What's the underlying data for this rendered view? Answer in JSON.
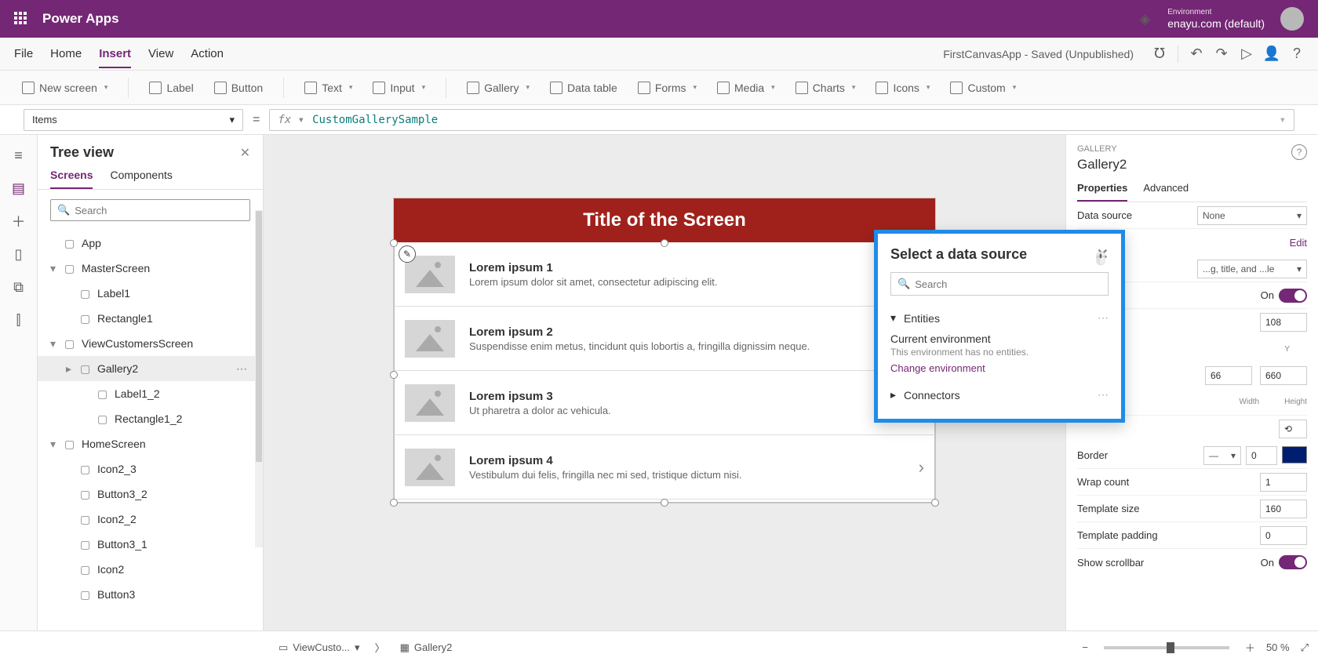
{
  "topbar": {
    "brand": "Power Apps",
    "env_label": "Environment",
    "env_value": "enayu.com (default)"
  },
  "menus": [
    "File",
    "Home",
    "Insert",
    "View",
    "Action"
  ],
  "menu_active": 2,
  "app_status": "FirstCanvasApp - Saved (Unpublished)",
  "ribbon": {
    "new_screen": "New screen",
    "label": "Label",
    "button": "Button",
    "text": "Text",
    "input": "Input",
    "gallery": "Gallery",
    "data_table": "Data table",
    "forms": "Forms",
    "media": "Media",
    "charts": "Charts",
    "icons": "Icons",
    "custom": "Custom"
  },
  "formula": {
    "prop": "Items",
    "value": "CustomGallerySample",
    "fx": "fx"
  },
  "tree": {
    "title": "Tree view",
    "tabs": [
      "Screens",
      "Components"
    ],
    "search_placeholder": "Search",
    "nodes": [
      {
        "label": "App",
        "level": 0,
        "icon": "app"
      },
      {
        "label": "MasterScreen",
        "level": 0,
        "icon": "screen",
        "exp": true
      },
      {
        "label": "Label1",
        "level": 1,
        "icon": "label"
      },
      {
        "label": "Rectangle1",
        "level": 1,
        "icon": "shape"
      },
      {
        "label": "ViewCustomersScreen",
        "level": 0,
        "icon": "screen",
        "exp": true
      },
      {
        "label": "Gallery2",
        "level": 1,
        "icon": "gallery",
        "selected": true,
        "more": true
      },
      {
        "label": "Label1_2",
        "level": 2,
        "icon": "label"
      },
      {
        "label": "Rectangle1_2",
        "level": 2,
        "icon": "shape"
      },
      {
        "label": "HomeScreen",
        "level": 0,
        "icon": "screen",
        "exp": true
      },
      {
        "label": "Icon2_3",
        "level": 1,
        "icon": "ico"
      },
      {
        "label": "Button3_2",
        "level": 1,
        "icon": "btn"
      },
      {
        "label": "Icon2_2",
        "level": 1,
        "icon": "ico"
      },
      {
        "label": "Button3_1",
        "level": 1,
        "icon": "btn"
      },
      {
        "label": "Icon2",
        "level": 1,
        "icon": "ico"
      },
      {
        "label": "Button3",
        "level": 1,
        "icon": "btn"
      }
    ]
  },
  "canvas": {
    "screen_title": "Title of the Screen",
    "rows": [
      {
        "title": "Lorem ipsum 1",
        "sub": "Lorem ipsum dolor sit amet, consectetur adipiscing elit."
      },
      {
        "title": "Lorem ipsum 2",
        "sub": "Suspendisse enim metus, tincidunt quis lobortis a, fringilla dignissim neque."
      },
      {
        "title": "Lorem ipsum 3",
        "sub": "Ut pharetra a dolor ac vehicula."
      },
      {
        "title": "Lorem ipsum 4",
        "sub": "Vestibulum dui felis, fringilla nec mi sed, tristique dictum nisi."
      }
    ]
  },
  "right": {
    "type_label": "GALLERY",
    "name": "Gallery2",
    "tabs": [
      "Properties",
      "Advanced"
    ],
    "data_source_label": "Data source",
    "data_source_value": "None",
    "edit": "Edit",
    "layout_hint": "...g, title, and ...le",
    "visible_label": "On",
    "pos_y": "108",
    "pos_y_label": "Y",
    "size_w_partial": "66",
    "size_h": "660",
    "width_label": "Width",
    "height_label": "Height",
    "border_label": "Border",
    "border_val": "0",
    "wrap_label": "Wrap count",
    "wrap_val": "1",
    "tsize_label": "Template size",
    "tsize_val": "160",
    "tpad_label": "Template padding",
    "tpad_val": "0",
    "scroll_label": "Show scrollbar",
    "scroll_val": "On"
  },
  "dspop": {
    "title": "Select a data source",
    "search_placeholder": "Search",
    "entities": "Entities",
    "current_env": "Current environment",
    "no_entities": "This environment has no entities.",
    "change_env": "Change environment",
    "connectors": "Connectors"
  },
  "statusbar": {
    "screen_name": "ViewCusto...",
    "gallery": "Gallery2",
    "zoom": "50",
    "pct": "%"
  }
}
